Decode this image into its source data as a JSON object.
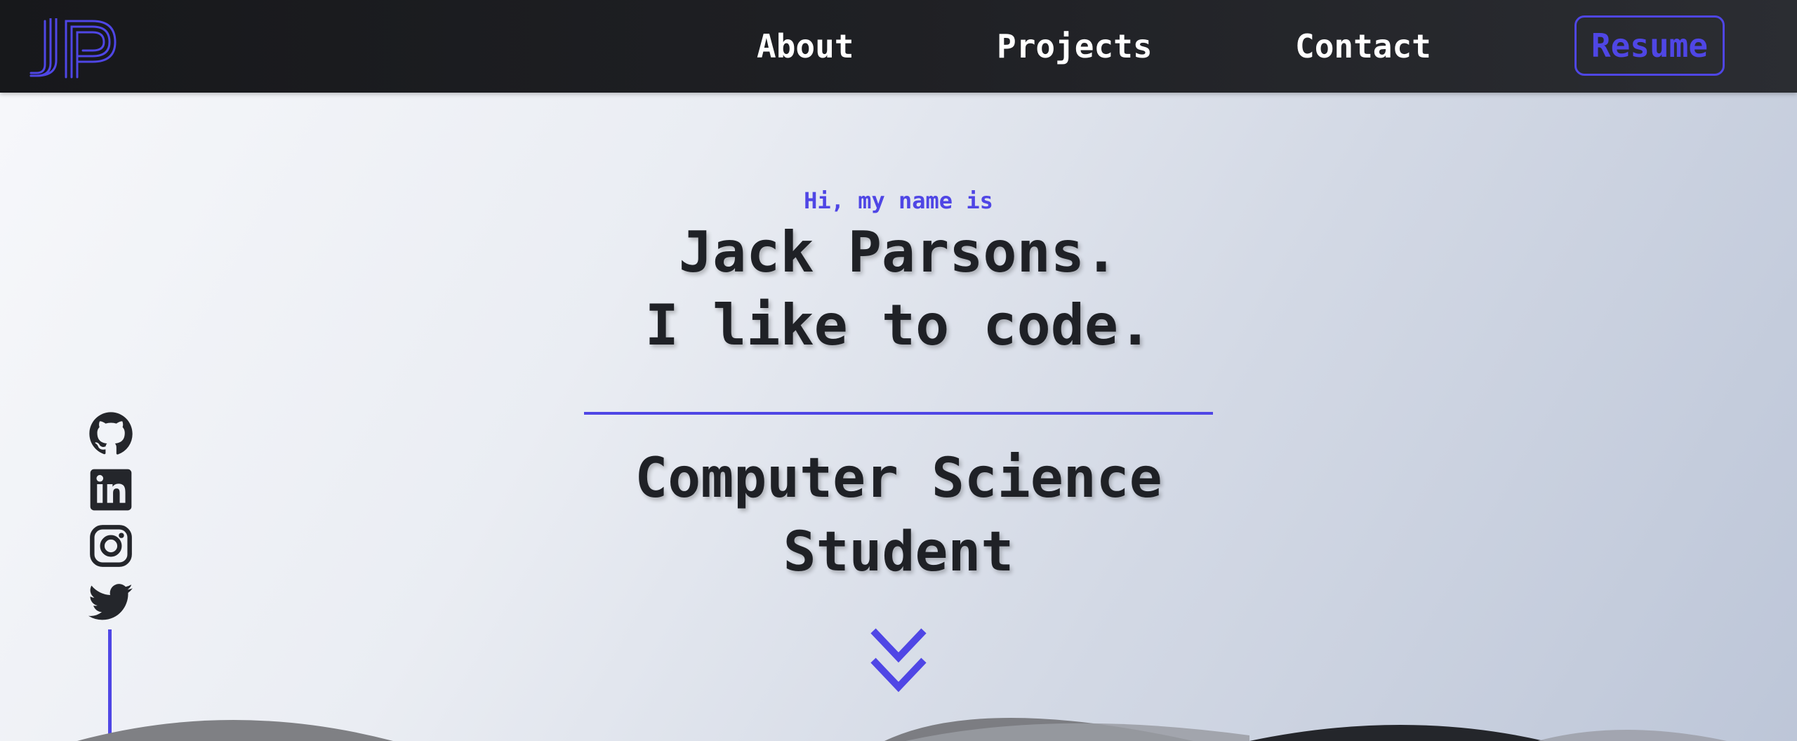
{
  "navbar": {
    "logo": {
      "text": "JP",
      "icon": "jp-monogram-logo"
    },
    "links": [
      {
        "label": "About"
      },
      {
        "label": "Projects"
      },
      {
        "label": "Contact"
      }
    ],
    "resume_label": "Resume"
  },
  "hero": {
    "greeting": "Hi, my name is",
    "title_line1": "Jack Parsons.",
    "title_line2": "I like to code.",
    "role_line1": "Computer Science",
    "role_line2": "Student",
    "scroll_icon": "double-chevron-down-icon"
  },
  "social_links": [
    {
      "name": "GitHub",
      "icon": "github-icon"
    },
    {
      "name": "LinkedIn",
      "icon": "linkedin-icon"
    },
    {
      "name": "Instagram",
      "icon": "instagram-icon"
    },
    {
      "name": "Twitter",
      "icon": "twitter-icon"
    }
  ],
  "colors": {
    "accent": "#4f46e5",
    "text_dark": "#1f2126",
    "nav_bg": "#1f2024",
    "nav_text": "#ffffff"
  }
}
